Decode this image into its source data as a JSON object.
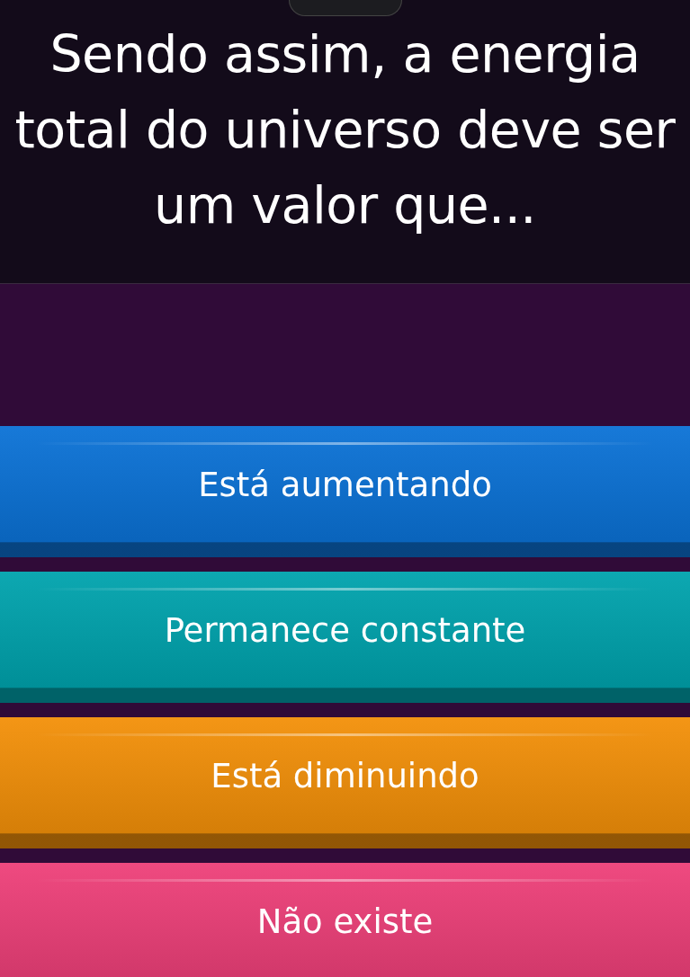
{
  "question": {
    "text": "Sendo assim, a energia total do universo deve ser um valor que..."
  },
  "answers": [
    {
      "label": "Está aumentando",
      "color": "#0b72d6"
    },
    {
      "label": "Permanece constante",
      "color": "#00a3ad"
    },
    {
      "label": "Está diminuindo",
      "color": "#f39009"
    },
    {
      "label": "Não existe",
      "color": "#ee4079"
    }
  ]
}
